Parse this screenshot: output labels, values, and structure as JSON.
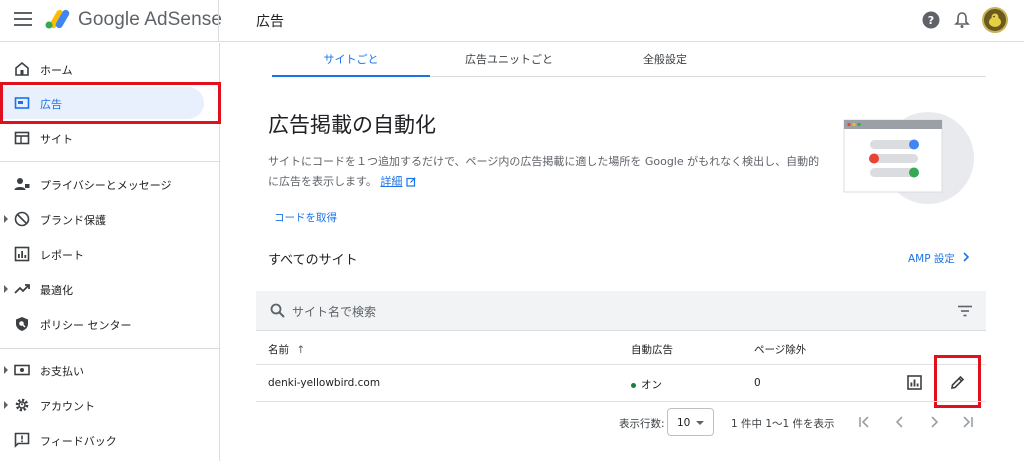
{
  "header": {
    "product_name": "Google AdSense",
    "page_title": "広告"
  },
  "sidebar": {
    "items": [
      {
        "label": "ホーム",
        "icon": "home-icon"
      },
      {
        "label": "広告",
        "icon": "ads-icon",
        "active": true
      },
      {
        "label": "サイト",
        "icon": "sites-icon"
      },
      {
        "label": "プライバシーとメッセージ",
        "icon": "privacy-icon"
      },
      {
        "label": "ブランド保護",
        "icon": "block-icon"
      },
      {
        "label": "レポート",
        "icon": "report-icon"
      },
      {
        "label": "最適化",
        "icon": "trending-icon"
      },
      {
        "label": "ポリシー センター",
        "icon": "policy-icon"
      },
      {
        "label": "お支払い",
        "icon": "payments-icon"
      },
      {
        "label": "アカウント",
        "icon": "account-gear-icon"
      },
      {
        "label": "フィードバック",
        "icon": "feedback-icon"
      }
    ]
  },
  "tabs": [
    {
      "label": "サイトごと",
      "active": true
    },
    {
      "label": "広告ユニットごと"
    },
    {
      "label": "全般設定"
    }
  ],
  "auto_ads": {
    "title": "広告掲載の自動化",
    "description": "サイトにコードを１つ追加するだけで、ページ内の広告掲載に適した場所を Google がもれなく検出し、自動的に広告を表示します。",
    "details_link": "詳細",
    "get_code": "コードを取得"
  },
  "sites": {
    "heading": "すべてのサイト",
    "amp_link": "AMP 設定",
    "search_placeholder": "サイト名で検索",
    "columns": {
      "name": "名前",
      "auto_ads": "自動広告",
      "page_exclusions": "ページ除外"
    },
    "sort_arrow": "↑",
    "rows": [
      {
        "name": "denki-yellowbird.com",
        "auto_ads": "オン",
        "page_exclusions": "0"
      }
    ],
    "pagination": {
      "rows_label": "表示行数:",
      "rows_value": "10",
      "range_text": "1 件中 1〜1 件を表示"
    }
  },
  "colors": {
    "accent": "#1a73e8",
    "highlight": "#e0101d",
    "status_on": "#188038"
  }
}
